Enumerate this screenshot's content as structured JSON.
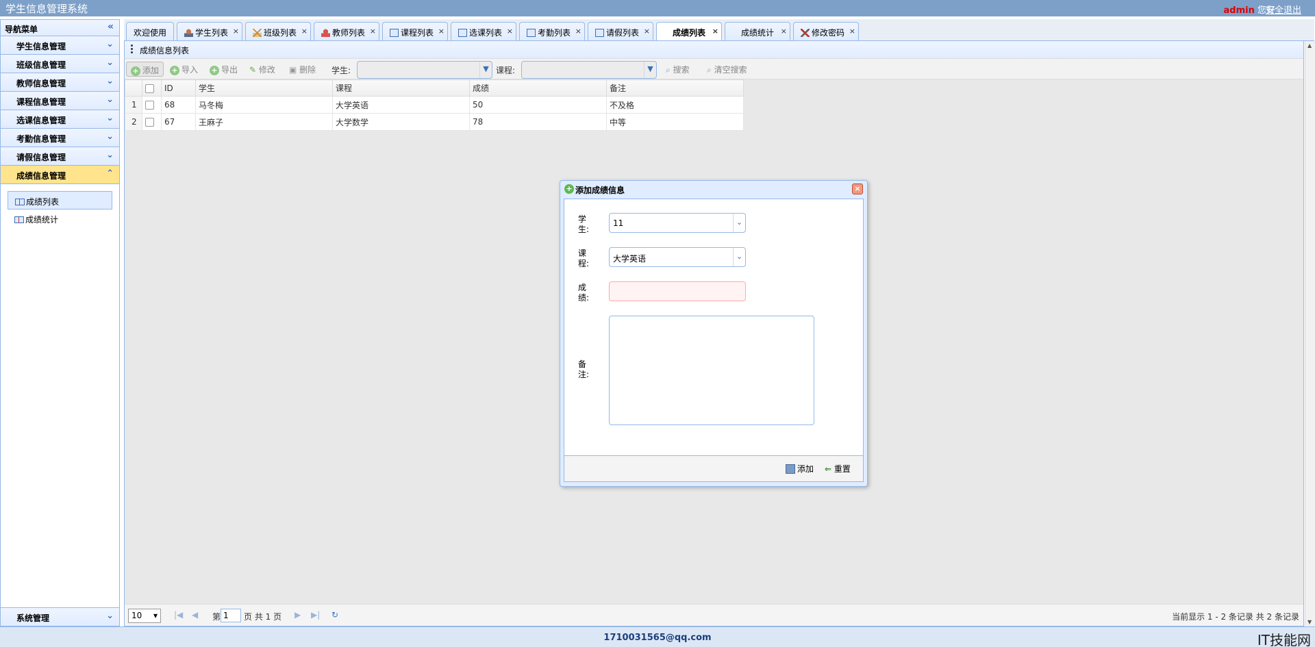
{
  "app": {
    "title": "学生信息管理系统",
    "user": "admin",
    "greeting": "您好",
    "logout": "安全退出"
  },
  "sidebar": {
    "title": "导航菜单",
    "items": [
      {
        "label": "学生信息管理"
      },
      {
        "label": "班级信息管理"
      },
      {
        "label": "教师信息管理"
      },
      {
        "label": "课程信息管理"
      },
      {
        "label": "选课信息管理"
      },
      {
        "label": "考勤信息管理"
      },
      {
        "label": "请假信息管理"
      },
      {
        "label": "成绩信息管理"
      }
    ],
    "subitems": [
      {
        "label": "成绩列表"
      },
      {
        "label": "成绩统计"
      }
    ],
    "system": "系统管理"
  },
  "tabs": [
    {
      "label": "欢迎使用"
    },
    {
      "label": "学生列表"
    },
    {
      "label": "班级列表"
    },
    {
      "label": "教师列表"
    },
    {
      "label": "课程列表"
    },
    {
      "label": "选课列表"
    },
    {
      "label": "考勤列表"
    },
    {
      "label": "请假列表"
    },
    {
      "label": "成绩列表"
    },
    {
      "label": "成绩统计"
    },
    {
      "label": "修改密码"
    }
  ],
  "panel": {
    "title": "成绩信息列表"
  },
  "toolbar": {
    "add": "添加",
    "import": "导入",
    "export": "导出",
    "edit": "修改",
    "delete": "删除",
    "student_label": "学生:",
    "course_label": "课程:",
    "search": "搜索",
    "clear": "清空搜索"
  },
  "grid": {
    "headers": [
      "ID",
      "学生",
      "课程",
      "成绩",
      "备注"
    ],
    "rows": [
      {
        "num": "1",
        "id": "68",
        "student": "马冬梅",
        "course": "大学英语",
        "score": "50",
        "remark": "不及格"
      },
      {
        "num": "2",
        "id": "67",
        "student": "王麻子",
        "course": "大学数学",
        "score": "78",
        "remark": "中等"
      }
    ]
  },
  "pager": {
    "page_size": "10",
    "page_prefix": "第",
    "page_value": "1",
    "page_suffix": "页 共 1 页",
    "info": "当前显示 1 - 2 条记录 共 2 条记录"
  },
  "dialog": {
    "title": "添加成绩信息",
    "student_label": "学生:",
    "student_value": "11",
    "course_label": "课程:",
    "course_value": "大学英语",
    "score_label": "成绩:",
    "remark_label": "备注:",
    "add_button": "添加",
    "reset_button": "重置"
  },
  "footer": {
    "email": "1710031565@qq.com",
    "watermark": "IT技能网"
  },
  "colors": {
    "header_bg": "#7da0c9",
    "panel_border": "#95b8e7",
    "active_menu": "#ffe48d",
    "username": "#dd0000"
  }
}
